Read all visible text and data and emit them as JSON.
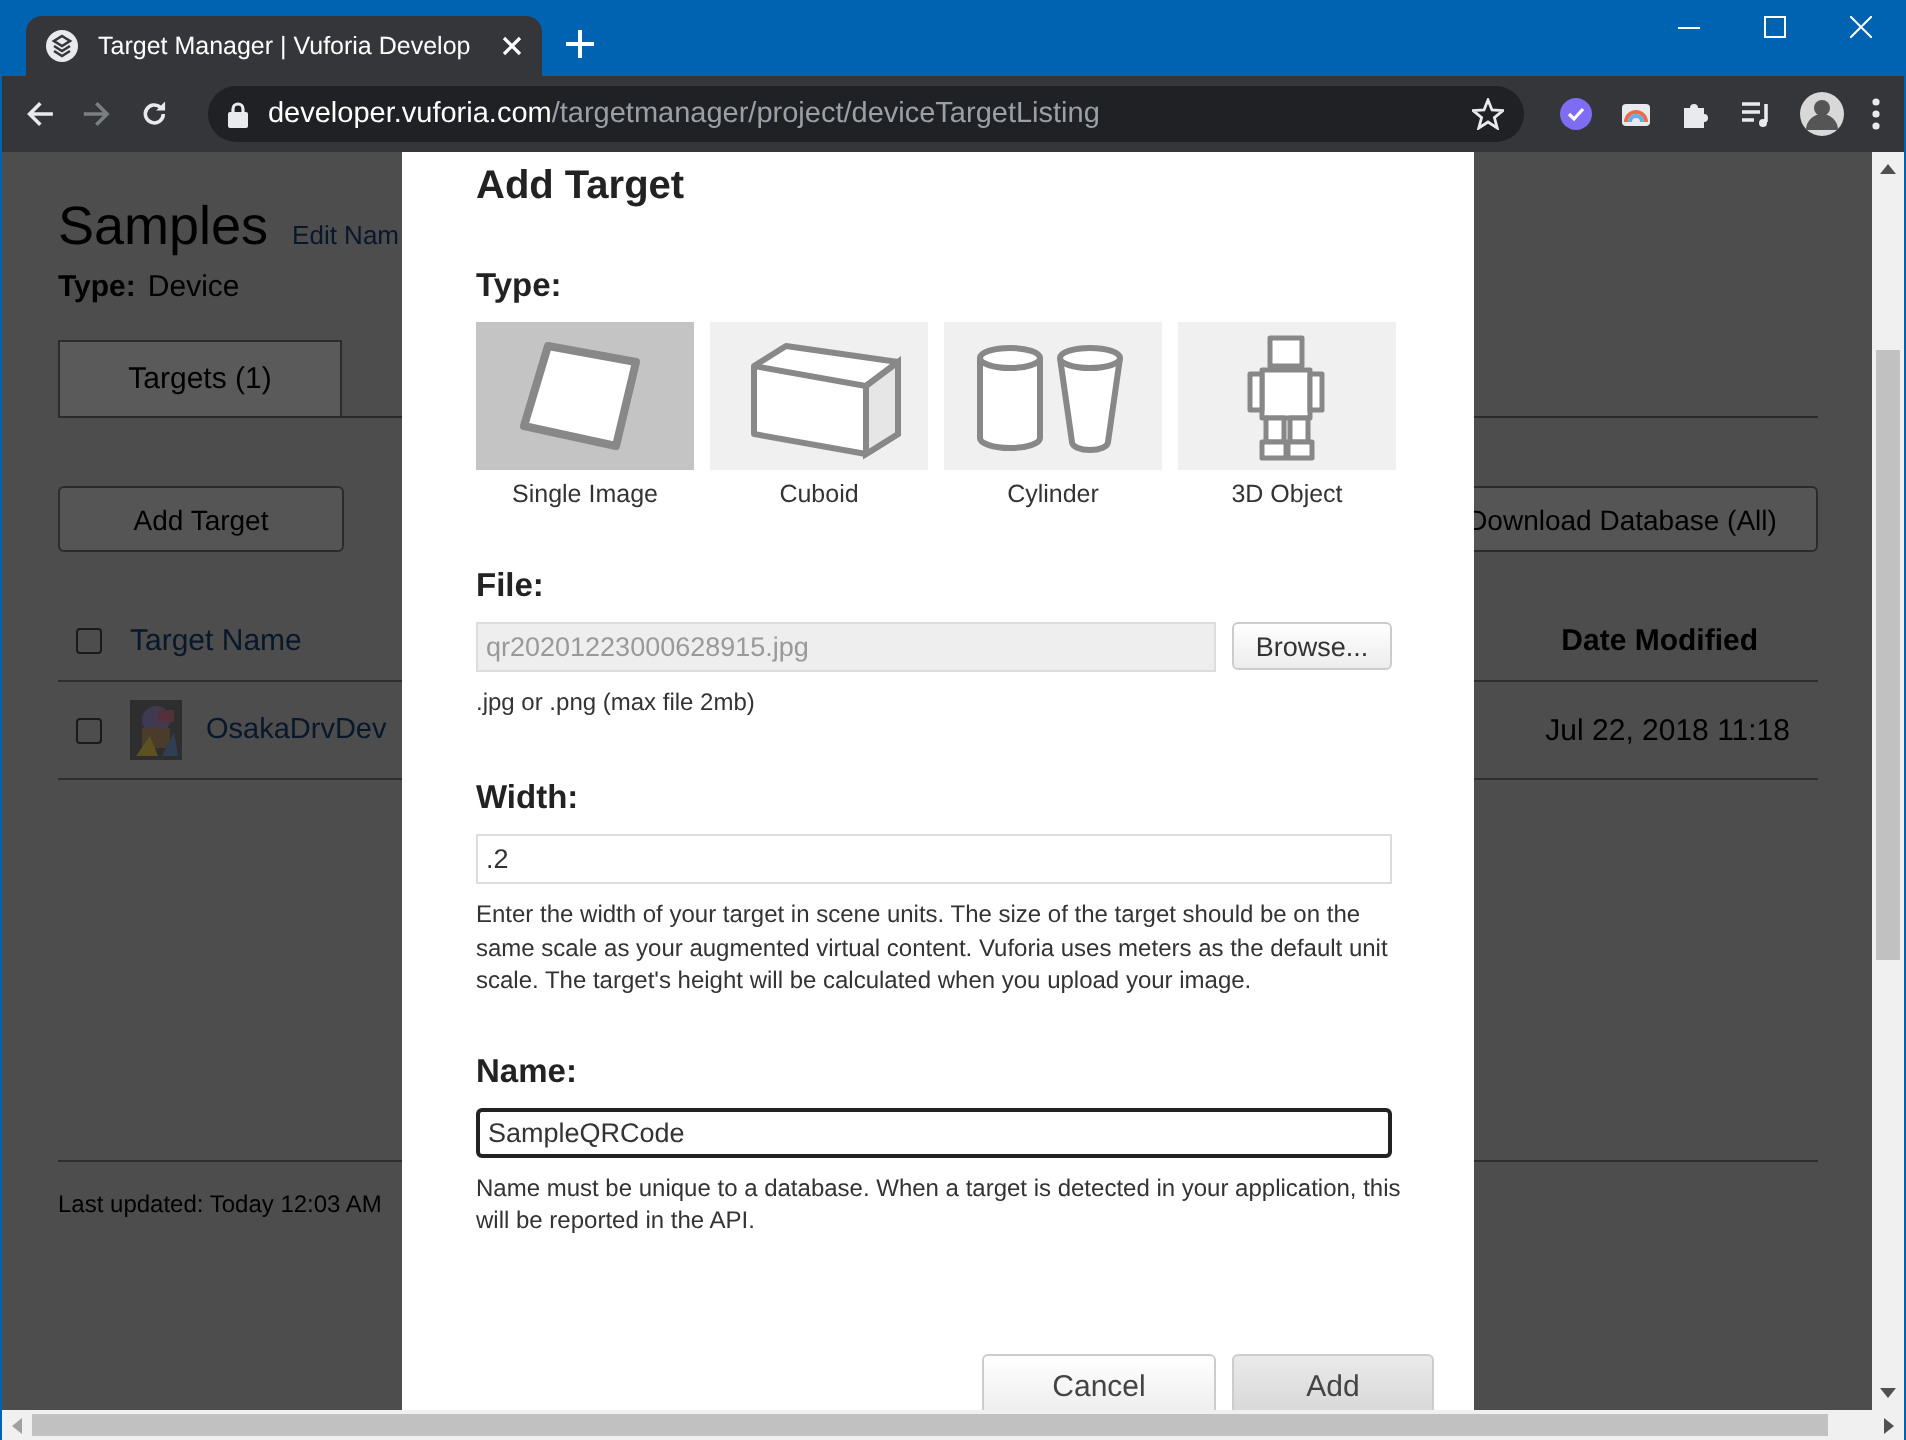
{
  "browser": {
    "tab_title": "Target Manager | Vuforia Develop",
    "url_domain": "developer.vuforia.com",
    "url_path": "/targetmanager/project/deviceTargetListing"
  },
  "page": {
    "title": "Samples",
    "edit_link": "Edit Nam",
    "type_label": "Type:",
    "type_value": "Device",
    "tabs": [
      {
        "label": "Targets (1)",
        "selected": true
      }
    ],
    "add_button": "Add Target",
    "download_button": "Download Database (All)",
    "columns": [
      "Target Name",
      "Date Modified"
    ],
    "header_checked": false,
    "rows": [
      {
        "name": "OsakaDrvDev",
        "date": "Jul 22, 2018 11:18",
        "checked": false
      }
    ],
    "last_updated": "Last updated: Today 12:03 AM"
  },
  "dialog": {
    "title": "Add Target",
    "type_label": "Type:",
    "types": [
      {
        "label": "Single Image",
        "selected": true
      },
      {
        "label": "Cuboid",
        "kind": "cuboid",
        "selected": false
      },
      {
        "label": "Cylinder",
        "kind": "cylinder",
        "selected": false
      },
      {
        "label": "3D Object",
        "kind": "object",
        "selected": false
      }
    ],
    "file": {
      "label": "File:",
      "value": "qr20201223000628915.jpg",
      "disabled": true,
      "browse_button": "Browse...",
      "hint": ".jpg or .png (max file 2mb)"
    },
    "width": {
      "label": "Width:",
      "value": ".2",
      "focused": false,
      "help": "Enter the width of your target in scene units. The size of the target should be on the same scale as your augmented virtual content. Vuforia uses meters as the default unit scale. The target's height will be calculated when you upload your image."
    },
    "name": {
      "label": "Name:",
      "value": "SampleQRCode",
      "focused": true,
      "help": "Name must be unique to a database. When a target is detected in your application, this will be reported in the API."
    },
    "buttons": [
      {
        "label": "Cancel",
        "kind": "secondary"
      },
      {
        "label": "Add",
        "kind": "primary"
      }
    ]
  }
}
